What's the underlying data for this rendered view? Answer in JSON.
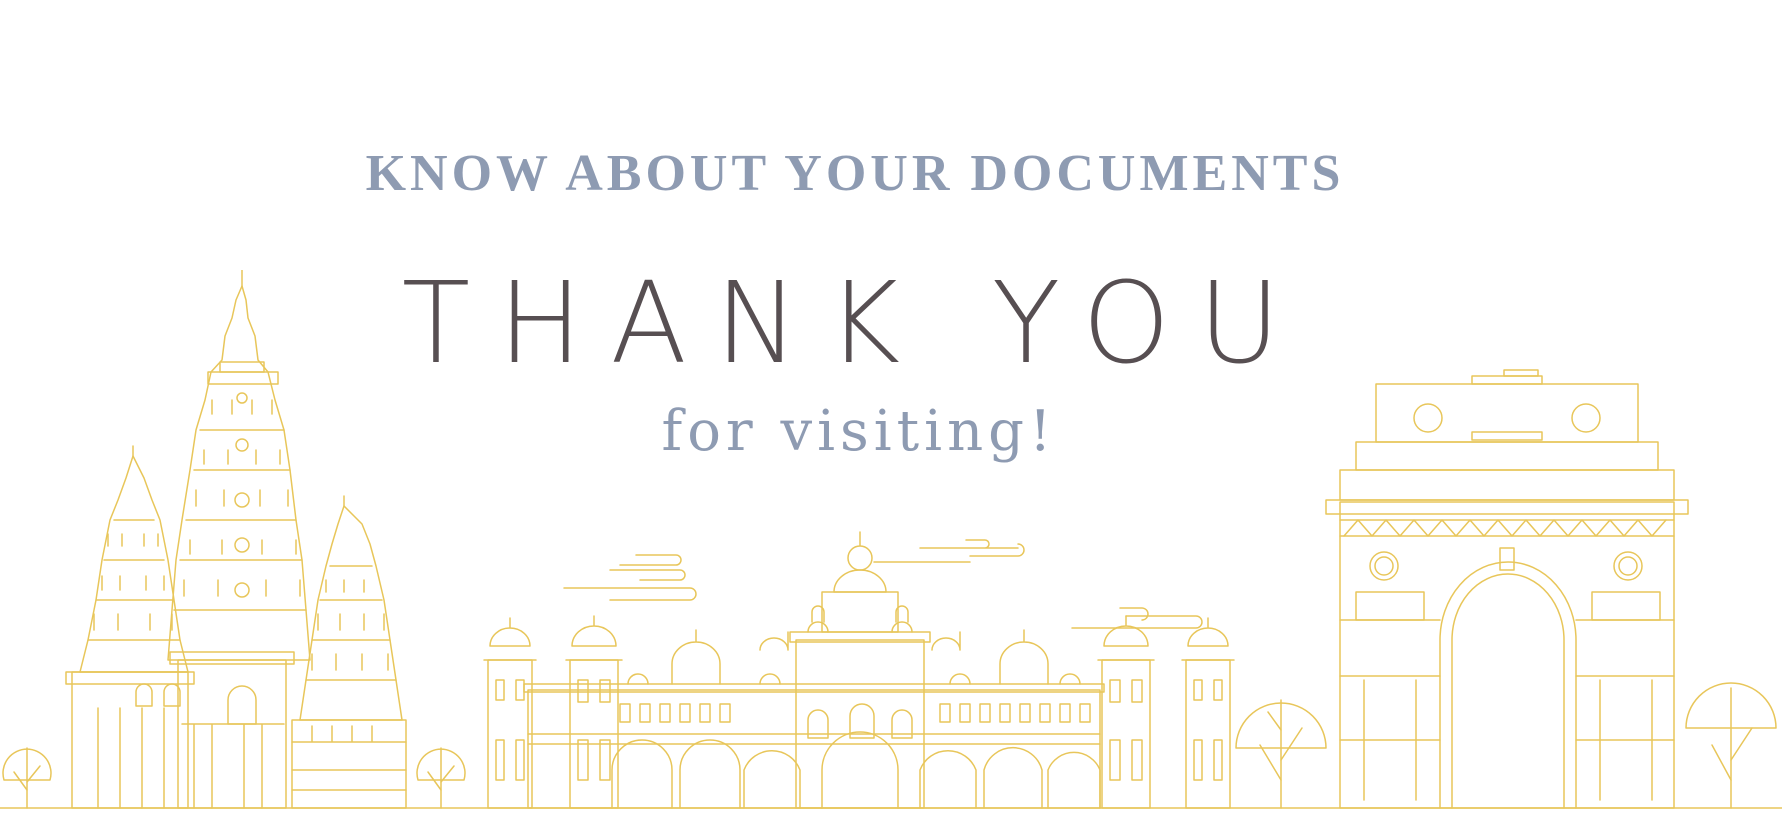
{
  "heading": {
    "kicker": "KNOW ABOUT YOUR DOCUMENTS",
    "title": "THANK YOU",
    "subtitle": "for visiting!"
  },
  "colors": {
    "kicker_text": "#8e9bb2",
    "title_text": "#574f52",
    "line_art": "#e8c65a",
    "background": "#ffffff"
  },
  "illustration": {
    "landmarks": [
      "temple-towers-icon",
      "palace-icon",
      "arch-gate-icon",
      "tree-icon",
      "cloud-icon"
    ]
  }
}
